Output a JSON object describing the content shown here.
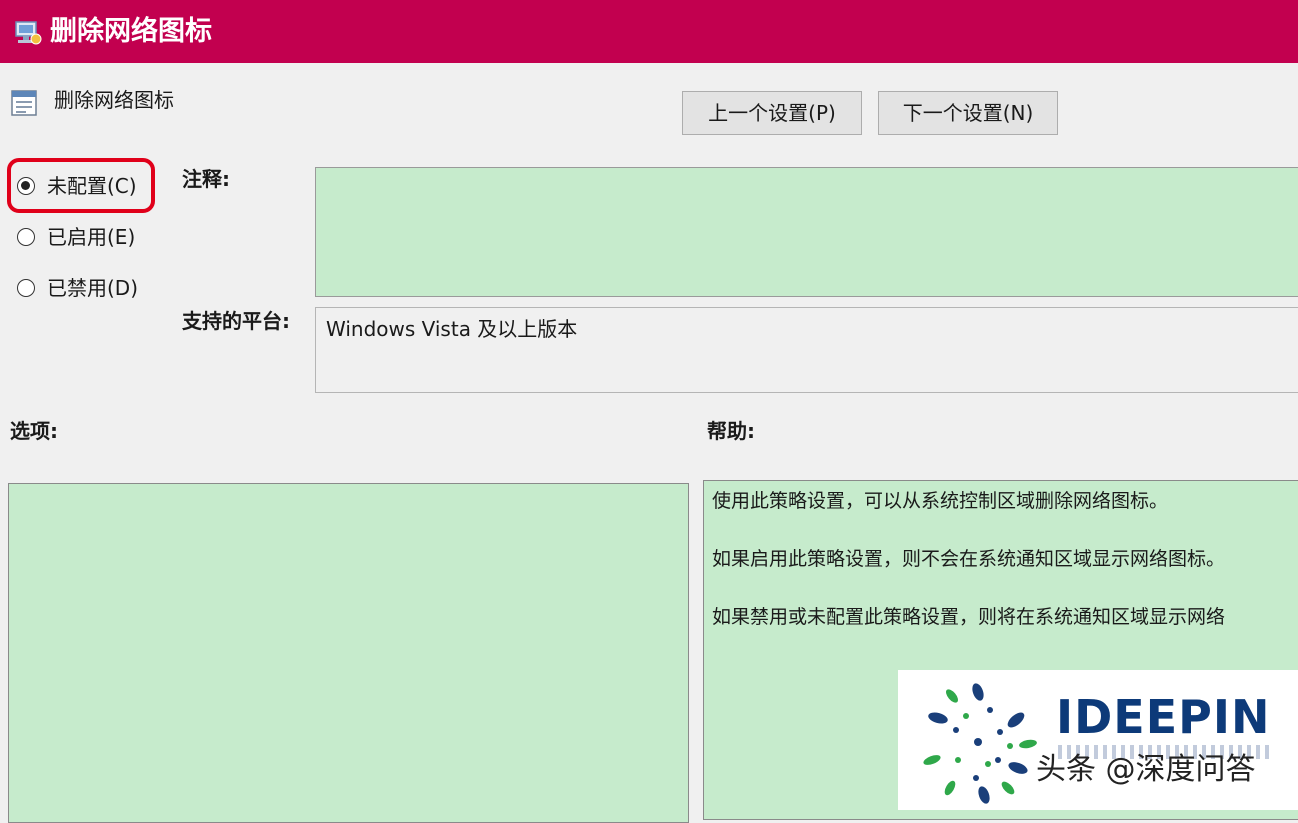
{
  "window": {
    "title": "删除网络图标",
    "titlebar_color": "#c2004f"
  },
  "policy": {
    "name": "删除网络图标"
  },
  "nav_buttons": {
    "prev": "上一个设置(P)",
    "next": "下一个设置(N)"
  },
  "state_options": {
    "selected": "not_configured",
    "not_configured": "未配置(C)",
    "enabled": "已启用(E)",
    "disabled": "已禁用(D)",
    "highlight_color": "#e0001a"
  },
  "comment": {
    "label": "注释:",
    "value": ""
  },
  "platform": {
    "label": "支持的平台:",
    "value": "Windows Vista 及以上版本"
  },
  "options": {
    "label": "选项:"
  },
  "help": {
    "label": "帮助:",
    "lines": [
      "使用此策略设置，可以从系统控制区域删除网络图标。",
      "如果启用此策略设置，则不会在系统通知区域显示网络图标。",
      "如果禁用或未配置此策略设置，则将在系统通知区域显示网络"
    ]
  },
  "watermark": {
    "brand": "IDEEPIN",
    "source": "头条 @深度问答",
    "brand_color": "#0d3a79"
  },
  "colors": {
    "field_green": "#c6ebcc",
    "dialog_bg": "#f0f0f0"
  }
}
